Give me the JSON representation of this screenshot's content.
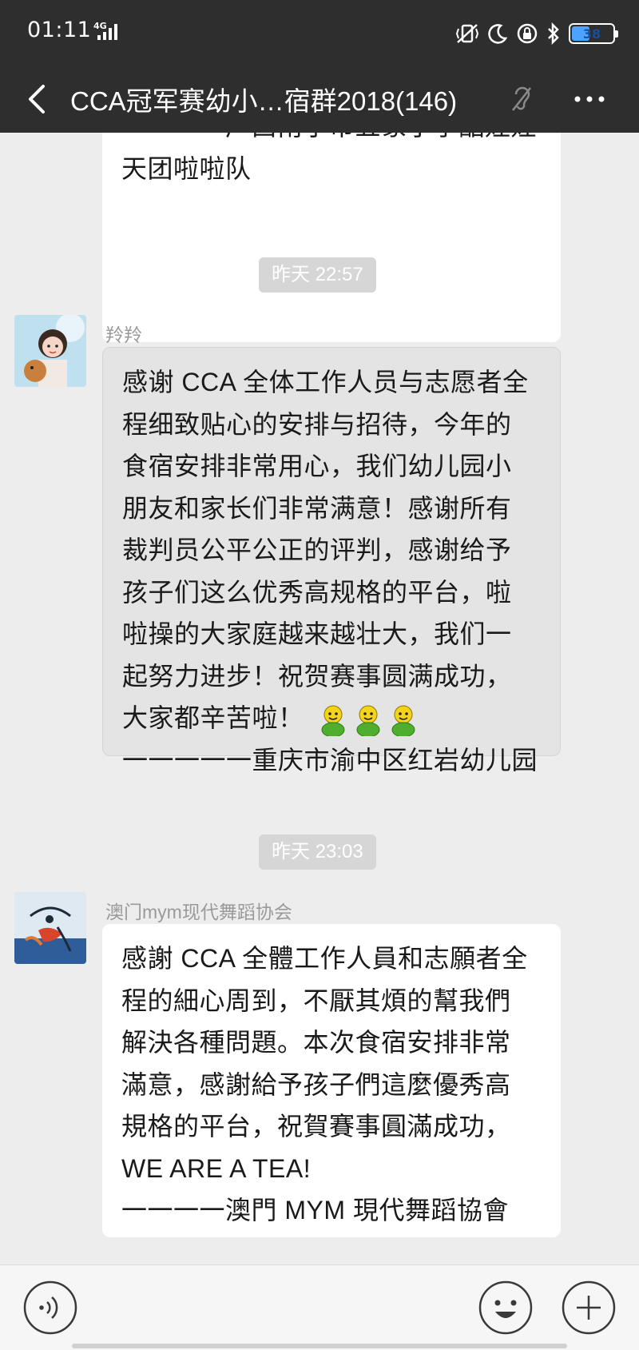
{
  "status_bar": {
    "time": "01:11",
    "network": "4G",
    "battery": "38"
  },
  "nav": {
    "title": "CCA冠军赛幼小…宿群2018(146)"
  },
  "messages": [
    {
      "type": "partial_bubble",
      "lines": [
        "一一一一广西南宁市五象小学酷娃娃",
        "天团啦啦队"
      ]
    },
    {
      "type": "timestamp",
      "text": "昨天 22:57"
    },
    {
      "type": "message",
      "sender": "羚羚",
      "lines": [
        "感谢 CCA 全体工作人员与志愿者全",
        "程细致贴心的安排与招待，今年的",
        "食宿安排非常用心，我们幼儿园小",
        "朋友和家长们非常满意！感谢所有",
        "裁判员公平公正的评判，感谢给予",
        "孩子们这么优秀高规格的平台，啦",
        "啦操的大家庭越来越壮大，我们一",
        "起努力进步！祝贺赛事圆满成功，",
        "大家都辛苦啦！",
        "一一一一一重庆市渝中区红岩幼儿园"
      ]
    },
    {
      "type": "timestamp",
      "text": "昨天 23:03"
    },
    {
      "type": "message",
      "sender": "澳门mym现代舞蹈协会",
      "lines": [
        "感謝 CCA 全體工作人員和志願者全",
        "程的細心周到，不厭其煩的幫我們",
        "解決各種問題。本次食宿安排非常",
        "滿意，感謝給予孩子們這麼優秀高",
        "規格的平台，祝賀賽事圓滿成功，",
        "WE ARE A TEA!",
        "一一一一澳門 MYM 現代舞蹈協會"
      ]
    }
  ],
  "icons": {
    "back": "back-arrow-icon",
    "mute": "ear-mute-icon",
    "more": "more-dots-icon",
    "voice": "voice-icon",
    "emoji": "smiley-icon",
    "plus": "plus-icon"
  },
  "colors": {
    "header_bg": "#2e2e2e",
    "chat_bg": "#ededed",
    "bubble_white": "#ffffff",
    "bubble_grey": "#e4e4e4",
    "timestamp_bg": "#d6d6d6",
    "emoji_green": "#4fae2d",
    "emoji_yellow": "#f4d31a"
  }
}
